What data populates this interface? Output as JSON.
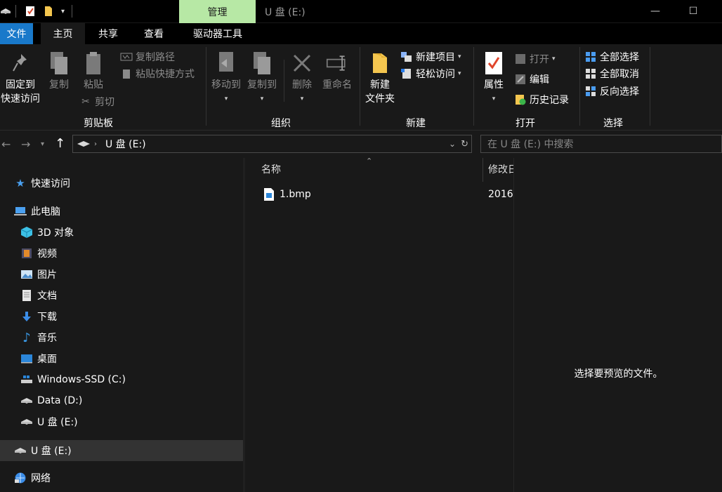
{
  "titlebar": {
    "manage_tab": "管理",
    "window_title": "U 盘 (E:)",
    "minimize": "—",
    "maximize": "☐"
  },
  "tabs": {
    "file": "文件",
    "home": "主页",
    "share": "共享",
    "view": "查看",
    "drive_tools": "驱动器工具"
  },
  "ribbon": {
    "clipboard": {
      "pin_line1": "固定到",
      "pin_line2": "快速访问",
      "copy": "复制",
      "paste": "粘贴",
      "copy_path": "复制路径",
      "paste_shortcut": "粘贴快捷方式",
      "cut": "剪切",
      "label": "剪贴板"
    },
    "organize": {
      "move_to": "移动到",
      "copy_to": "复制到",
      "delete": "删除",
      "rename": "重命名",
      "label": "组织"
    },
    "new": {
      "new_folder_line1": "新建",
      "new_folder_line2": "文件夹",
      "new_item": "新建项目",
      "easy_access": "轻松访问",
      "label": "新建"
    },
    "open": {
      "properties": "属性",
      "open": "打开",
      "edit": "编辑",
      "history": "历史记录",
      "label": "打开"
    },
    "select": {
      "select_all": "全部选择",
      "select_none": "全部取消",
      "invert": "反向选择",
      "label": "选择"
    }
  },
  "address": {
    "path": "U 盘 (E:)",
    "search_placeholder": "在 U 盘 (E:) 中搜索"
  },
  "nav": {
    "quick_access": "快速访问",
    "this_pc": "此电脑",
    "objects3d": "3D 对象",
    "videos": "视频",
    "pictures": "图片",
    "documents": "文档",
    "downloads": "下载",
    "music": "音乐",
    "desktop": "桌面",
    "drive_c": "Windows-SSD (C:)",
    "drive_d": "Data (D:)",
    "drive_e": "U 盘 (E:)",
    "drive_e_root": "U 盘 (E:)",
    "network": "网络"
  },
  "content": {
    "col_name": "名称",
    "col_modified": "修改日",
    "files": [
      {
        "name": "1.bmp",
        "modified": "2016"
      }
    ]
  },
  "preview": {
    "message": "选择要预览的文件。"
  },
  "colors": {
    "accent": "#1979ca",
    "manage_tab": "#b7e8a5",
    "background": "#191919",
    "selected": "#333333"
  }
}
